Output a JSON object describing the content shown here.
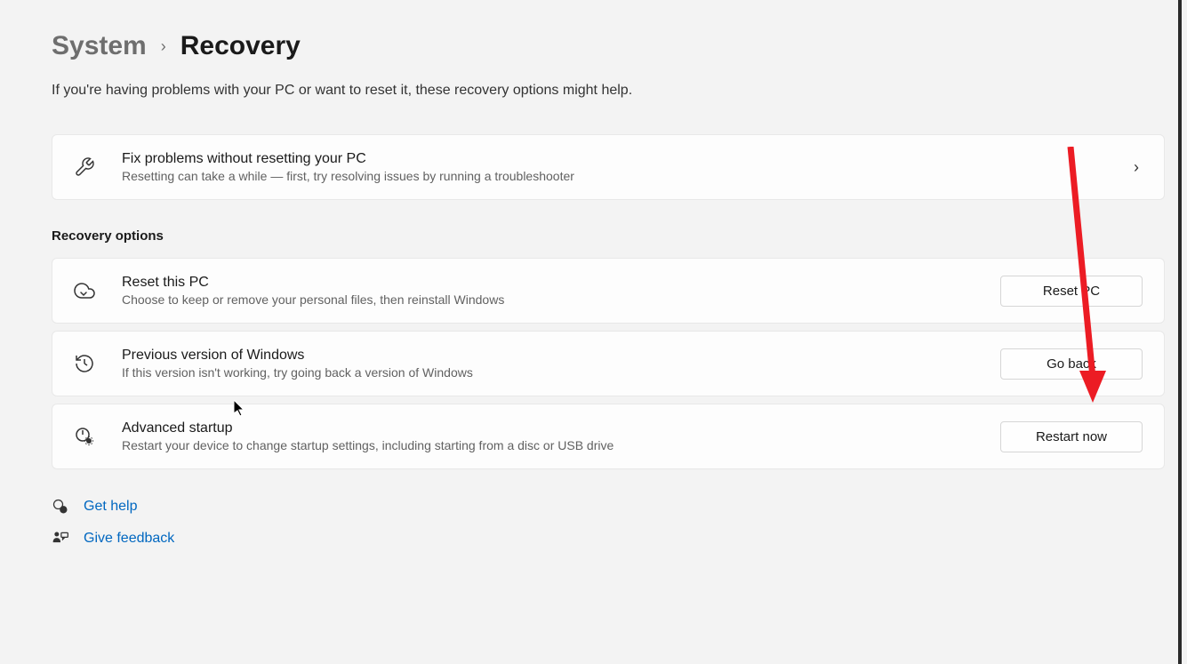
{
  "breadcrumb": {
    "parent": "System",
    "current": "Recovery"
  },
  "intro_text": "If you're having problems with your PC or want to reset it, these recovery options might help.",
  "troubleshoot_card": {
    "title": "Fix problems without resetting your PC",
    "subtitle": "Resetting can take a while — first, try resolving issues by running a troubleshooter"
  },
  "section_heading": "Recovery options",
  "reset_card": {
    "title": "Reset this PC",
    "subtitle": "Choose to keep or remove your personal files, then reinstall Windows",
    "button": "Reset PC"
  },
  "previous_card": {
    "title": "Previous version of Windows",
    "subtitle": "If this version isn't working, try going back a version of Windows",
    "button": "Go back"
  },
  "advanced_card": {
    "title": "Advanced startup",
    "subtitle": "Restart your device to change startup settings, including starting from a disc or USB drive",
    "button": "Restart now"
  },
  "links": {
    "get_help": "Get help",
    "give_feedback": "Give feedback"
  }
}
